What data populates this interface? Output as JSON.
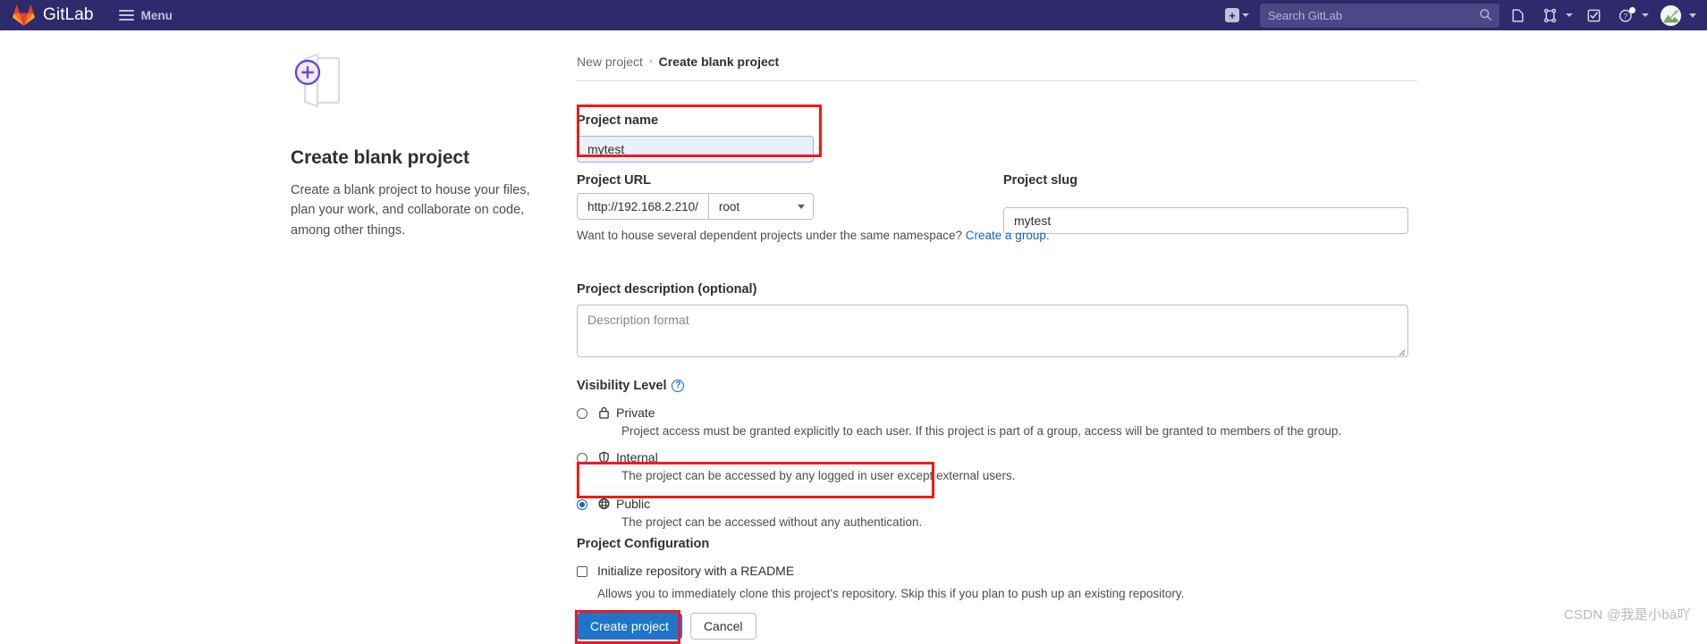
{
  "navbar": {
    "brand": "GitLab",
    "menu_label": "Menu",
    "search_placeholder": "Search GitLab",
    "icons": {
      "plus": "plus-icon",
      "search": "search-icon",
      "issues": "issues-icon",
      "merge_requests": "merge-requests-icon",
      "todos": "todos-icon",
      "help": "help-icon",
      "avatar": "avatar-icon"
    },
    "brand_color": "#2f2a6b",
    "search_bg": "#4c4787"
  },
  "promo": {
    "title": "Create blank project",
    "description": "Create a blank project to house your files, plan your work, and collaborate on code, among other things.",
    "illustration": "blank-project-illustration",
    "accent_color": "#6e49cb"
  },
  "breadcrumb": {
    "parent": "New project",
    "separator": "›",
    "current": "Create blank project"
  },
  "form": {
    "project_name": {
      "label": "Project name",
      "value": "mytest",
      "placeholder": ""
    },
    "project_url": {
      "label": "Project URL",
      "prefix": "http://192.168.2.210/",
      "namespace": "root"
    },
    "project_slug": {
      "label": "Project slug",
      "value": "mytest"
    },
    "url_help": {
      "text": "Want to house several dependent projects under the same namespace? ",
      "link": "Create a group."
    },
    "description": {
      "label": "Project description (optional)",
      "placeholder": "Description format",
      "value": ""
    },
    "visibility": {
      "label": "Visibility Level",
      "help_icon": "question-circle-icon",
      "selected": "public",
      "options": [
        {
          "id": "private",
          "name": "Private",
          "icon": "lock-icon",
          "description": "Project access must be granted explicitly to each user. If this project is part of a group, access will be granted to members of the group.",
          "checked": false
        },
        {
          "id": "internal",
          "name": "Internal",
          "icon": "shield-icon",
          "description": "The project can be accessed by any logged in user except external users.",
          "checked": false
        },
        {
          "id": "public",
          "name": "Public",
          "icon": "globe-icon",
          "description": "The project can be accessed without any authentication.",
          "checked": true
        }
      ]
    },
    "configuration": {
      "label": "Project Configuration",
      "readme": {
        "label": "Initialize repository with a README",
        "description": "Allows you to immediately clone this project's repository. Skip this if you plan to push up an existing repository.",
        "checked": false
      }
    },
    "actions": {
      "submit": "Create project",
      "cancel": "Cancel",
      "submit_color": "#1f75cb"
    }
  },
  "annotations": {
    "highlight_color": "#ee1b1b",
    "boxes": [
      "project-name-field",
      "public-visibility-option",
      "create-project-button"
    ]
  },
  "watermark": "CSDN @我是小bā吖"
}
